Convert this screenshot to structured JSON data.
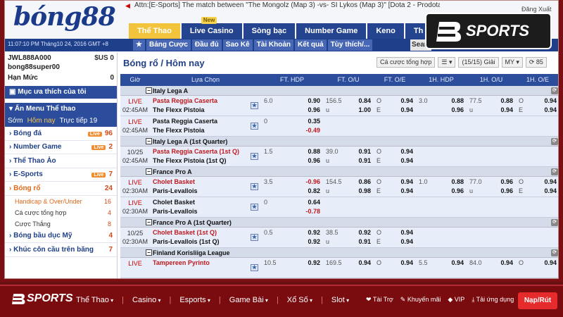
{
  "header": {
    "logo": "bóng88",
    "ticker": "Attn:[E-Sports] The match between \"The Mongolz (Map 3) -vs- SI Lykos (Map 3)\" [Dota 2 - Prodota Cup",
    "logout": "Đăng Xuất",
    "tabs": [
      "Thể Thao",
      "Live Casino",
      "Sòng bạc",
      "Number Game",
      "Keno",
      "Th"
    ],
    "new_badge": "New",
    "datetime": "11:07:10 PM Tháng10 24, 2016 GMT +8",
    "subnav": [
      "★",
      "Bảng Cược",
      "Đầu đủ",
      "Sao Kê",
      "Tài Khoản",
      "Kết quả",
      "Tùy thích/..."
    ],
    "search": "Sear"
  },
  "sidebar": {
    "account": "JWL888A000",
    "currency": "$US 0",
    "username": "bong88super00",
    "limit_label": "Hạn Mức",
    "limit_value": "0",
    "favorites": "Mục ưa thích của tôi",
    "menu_toggle": "Ẩn Menu Thể thao",
    "timetabs": [
      "Sớm",
      "Hôm nay",
      "Trực tiếp 19"
    ],
    "sports": [
      {
        "name": "Bóng đá",
        "live": "Live",
        "count": "96"
      },
      {
        "name": "Number Game",
        "live": "Live",
        "count": "2"
      },
      {
        "name": "Thể Thao Ảo",
        "live": "",
        "count": ""
      },
      {
        "name": "E-Sports",
        "live": "Live",
        "count": "7"
      },
      {
        "name": "Bóng rổ",
        "live": "",
        "count": "24"
      }
    ],
    "subs": [
      {
        "name": "Handicap & Over/Under",
        "count": "16"
      },
      {
        "name": "Cá cược tổng hợp",
        "count": "4"
      },
      {
        "name": "Cược Thắng",
        "count": "8"
      }
    ],
    "more": [
      {
        "name": "Bóng bầu dục Mỹ",
        "count": "4"
      },
      {
        "name": "Khúc côn cầu trên băng",
        "count": "7"
      }
    ]
  },
  "main": {
    "breadcrumb": "Bóng rổ / Hôm nay",
    "tools": [
      "Cá cược tổng hợp",
      "☰ ▾",
      "(15/15) Giải",
      "MY ▾",
      "⟳ 85"
    ],
    "columns": [
      "Giờ",
      "Lựa Chọn",
      "FT. HDP",
      "FT. O/U",
      "FT. O/E",
      "1H. HDP",
      "1H. O/U",
      "1H. O/E"
    ],
    "rows": [
      {
        "type": "league",
        "name": "Italy Lega A"
      },
      {
        "type": "match",
        "t1": "LIVE",
        "t2": "02:45AM",
        "home": "Pasta Reggia Caserta",
        "away": "The Flexx Pistoia",
        "fav": "home",
        "hdp": [
          "6.0",
          "0.90",
          "",
          "0.96"
        ],
        "ou": [
          "156.5",
          "0.84",
          "u",
          "1.00"
        ],
        "oe": [
          "O",
          "0.94",
          "E",
          "0.94"
        ],
        "h1": [
          "3.0",
          "0.88",
          "",
          "0.96"
        ],
        "h1ou": [
          "77.5",
          "0.88",
          "u",
          "0.94"
        ],
        "h1oe": [
          "O",
          "0.94",
          "E",
          "0.94"
        ]
      },
      {
        "type": "match",
        "t1": "LIVE",
        "t2": "02:45AM",
        "home": "Pasta Reggia Caserta",
        "away": "The Flexx Pistoia",
        "fav": "none",
        "hdp": [
          "0",
          "0.35",
          "",
          "-0.49"
        ],
        "ou": [
          "",
          "",
          "",
          ""
        ],
        "oe": [
          "",
          "",
          "",
          ""
        ],
        "h1": [
          "",
          "",
          "",
          ""
        ],
        "h1ou": [
          "",
          "",
          "",
          ""
        ],
        "h1oe": [
          "",
          "",
          "",
          ""
        ]
      },
      {
        "type": "league",
        "name": "Italy Lega A (1st Quarter)"
      },
      {
        "type": "match",
        "t1": "10/25",
        "t2": "02:45AM",
        "home": "Pasta Reggia Caserta (1st Q)",
        "away": "The Flexx Pistoia (1st Q)",
        "fav": "home",
        "hdp": [
          "1.5",
          "0.88",
          "",
          "0.96"
        ],
        "ou": [
          "39.0",
          "0.91",
          "u",
          "0.91"
        ],
        "oe": [
          "O",
          "0.94",
          "E",
          "0.94"
        ],
        "h1": [
          "",
          "",
          "",
          ""
        ],
        "h1ou": [
          "",
          "",
          "",
          ""
        ],
        "h1oe": [
          "",
          "",
          "",
          ""
        ]
      },
      {
        "type": "league",
        "name": "France Pro A"
      },
      {
        "type": "match",
        "t1": "LIVE",
        "t2": "02:30AM",
        "home": "Cholet Basket",
        "away": "Paris-Levallois",
        "fav": "home",
        "hdp": [
          "3.5",
          "-0.96",
          "",
          "0.82"
        ],
        "ou": [
          "154.5",
          "0.86",
          "u",
          "0.98"
        ],
        "oe": [
          "O",
          "0.94",
          "E",
          "0.94"
        ],
        "h1": [
          "1.0",
          "0.88",
          "",
          "0.96"
        ],
        "h1ou": [
          "77.0",
          "0.96",
          "u",
          "0.96"
        ],
        "h1oe": [
          "O",
          "0.94",
          "E",
          "0.94"
        ]
      },
      {
        "type": "match",
        "t1": "LIVE",
        "t2": "02:30AM",
        "home": "Cholet Basket",
        "away": "Paris-Levallois",
        "fav": "none",
        "hdp": [
          "0",
          "0.64",
          "",
          "-0.78"
        ],
        "ou": [
          "",
          "",
          "",
          ""
        ],
        "oe": [
          "",
          "",
          "",
          ""
        ],
        "h1": [
          "",
          "",
          "",
          ""
        ],
        "h1ou": [
          "",
          "",
          "",
          ""
        ],
        "h1oe": [
          "",
          "",
          "",
          ""
        ]
      },
      {
        "type": "league",
        "name": "France Pro A (1st Quarter)"
      },
      {
        "type": "match",
        "t1": "10/25",
        "t2": "02:30AM",
        "home": "Cholet Basket (1st Q)",
        "away": "Paris-Levallois (1st Q)",
        "fav": "home",
        "hdp": [
          "0.5",
          "0.92",
          "",
          "0.92"
        ],
        "ou": [
          "38.5",
          "0.92",
          "u",
          "0.91"
        ],
        "oe": [
          "O",
          "0.94",
          "E",
          "0.94"
        ],
        "h1": [
          "",
          "",
          "",
          ""
        ],
        "h1ou": [
          "",
          "",
          "",
          ""
        ],
        "h1oe": [
          "",
          "",
          "",
          ""
        ]
      },
      {
        "type": "league",
        "name": "Finland Korisliiga League"
      },
      {
        "type": "match",
        "t1": "LIVE",
        "t2": "",
        "home": "Tampereen Pyrinto",
        "away": "",
        "fav": "home",
        "hdp": [
          "10.5",
          "0.92",
          "",
          ""
        ],
        "ou": [
          "169.5",
          "0.94",
          "",
          ""
        ],
        "oe": [
          "O",
          "0.94",
          "",
          ""
        ],
        "h1": [
          "5.5",
          "0.94",
          "",
          ""
        ],
        "h1ou": [
          "84.0",
          "0.94",
          "",
          ""
        ],
        "h1oe": [
          "O",
          "0.94",
          "",
          ""
        ]
      }
    ]
  },
  "badge": {
    "label": "SPORTS"
  },
  "bottombar": {
    "logo": "SPORTS",
    "menu": [
      "Thể Thao",
      "Casino",
      "Esports",
      "Game Bài",
      "Xổ Số",
      "Slot"
    ],
    "right": [
      "Tài Trợ",
      "Khuyến mãi",
      "VIP",
      "Tải ứng dụng"
    ],
    "cta": "Nạp/Rút"
  }
}
